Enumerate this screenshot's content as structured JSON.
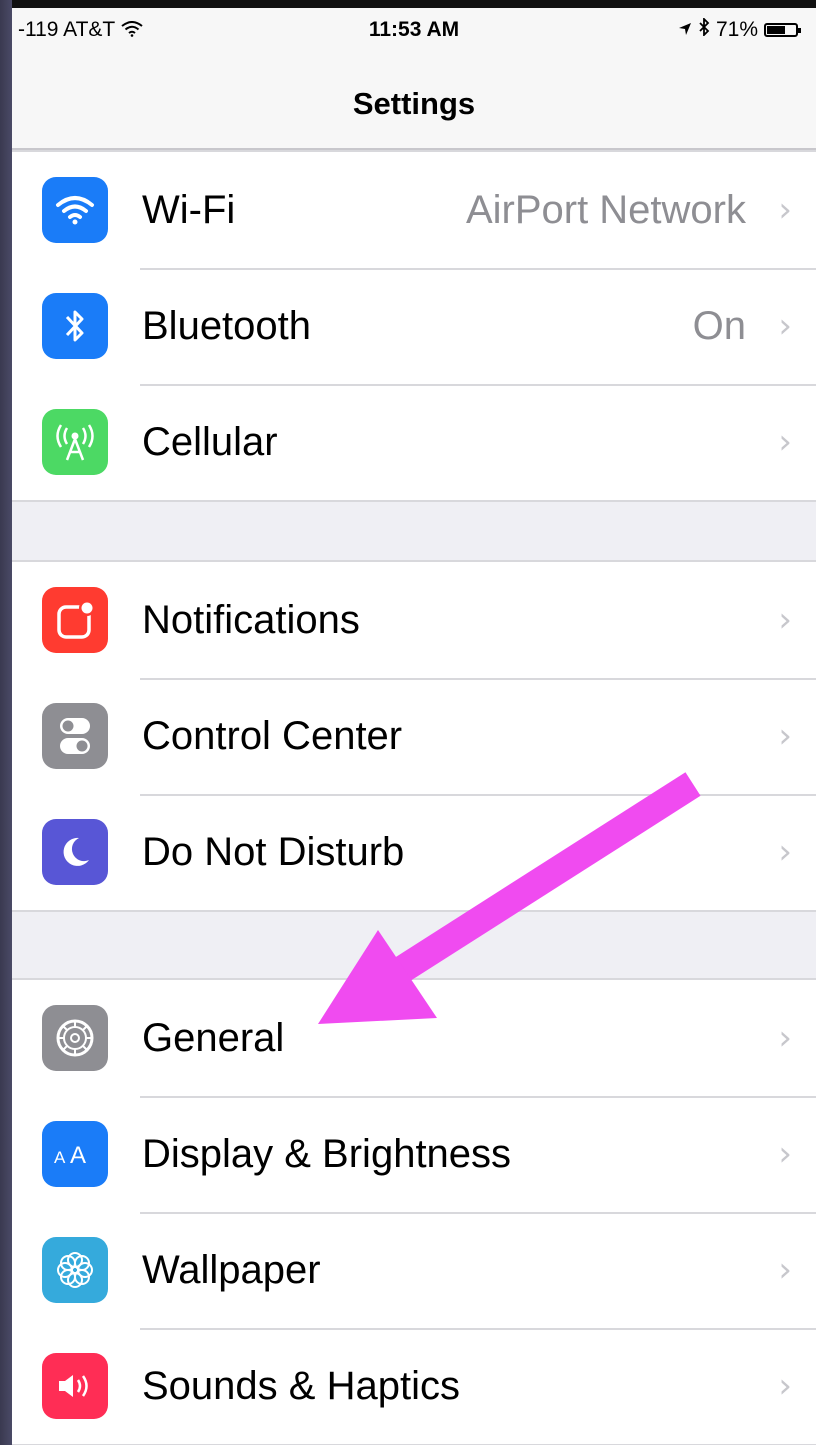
{
  "status_bar": {
    "carrier": "-119 AT&T",
    "time": "11:53 AM",
    "battery": "71%",
    "battery_level": 0.71
  },
  "nav": {
    "title": "Settings"
  },
  "groups": [
    {
      "rows": [
        {
          "label": "Wi-Fi",
          "detail": "AirPort Network",
          "icon": "wifi-icon",
          "color": "#1a7cf8"
        },
        {
          "label": "Bluetooth",
          "detail": "On",
          "icon": "bluetooth-icon",
          "color": "#1a7cf8"
        },
        {
          "label": "Cellular",
          "detail": "",
          "icon": "cellular-icon",
          "color": "#4cd964"
        }
      ]
    },
    {
      "rows": [
        {
          "label": "Notifications",
          "detail": "",
          "icon": "notifications-icon",
          "color": "#ff3b30"
        },
        {
          "label": "Control Center",
          "detail": "",
          "icon": "control-center-icon",
          "color": "#8e8e93"
        },
        {
          "label": "Do Not Disturb",
          "detail": "",
          "icon": "moon-icon",
          "color": "#5856d6"
        }
      ]
    },
    {
      "rows": [
        {
          "label": "General",
          "detail": "",
          "icon": "gear-icon",
          "color": "#8e8e93"
        },
        {
          "label": "Display & Brightness",
          "detail": "",
          "icon": "display-brightness-icon",
          "color": "#1a7cf8"
        },
        {
          "label": "Wallpaper",
          "detail": "",
          "icon": "wallpaper-icon",
          "color": "#35aadc"
        },
        {
          "label": "Sounds & Haptics",
          "detail": "",
          "icon": "speaker-icon",
          "color": "#ff2d55"
        }
      ]
    }
  ],
  "annotation": {
    "arrow_color": "#f04bf0"
  }
}
